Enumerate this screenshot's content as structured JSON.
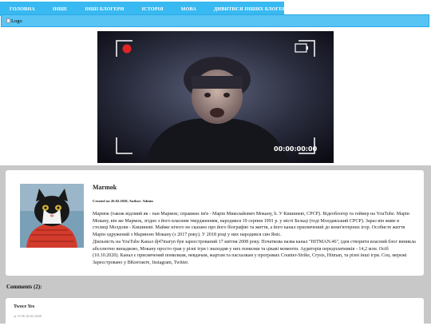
{
  "nav": {
    "items": [
      {
        "label": "ГОЛОВНА"
      },
      {
        "label": "ІНШЕ"
      },
      {
        "label": "ІНШІ БЛОГЕРИ"
      },
      {
        "label": "ІСТОРІЯ"
      },
      {
        "label": "МОВА"
      },
      {
        "label": "ДИВИТИСЯ ІНШИХ БЛОГЕРІВ"
      }
    ]
  },
  "header": {
    "logo_alt": "Logo"
  },
  "video": {
    "timecode": "00:00:00:00",
    "rec_color": "#e12424"
  },
  "post": {
    "title": "Marmok",
    "meta": "Created on 26.02.2020, Author: Admin",
    "paragraph1": "Мармок (також відомий як - пан Мармок; справжнє ім'я - Марін Миколайович Мокану, b. У Кишиневі, СРСР). Відеоблогер та геймер на YouTube. Марін Мокану, він же Мармок, згідно з його власним твердженням, народився 19 серпня 1991 р. у місті Бельці (тоді Молдавський СРСР). Зараз він живе в столиці Молдови - Кишиневі. Майже нічого не сказано про його біографію та життя, а його канал присвячений до комп'ютерних ігор. Особисте життя Марін одружений з Мариною Мокану (з 2017 року). У 2018 році у них народився син Яніс.",
    "paragraph2": "Діяльність на YouTube Канал dj47maryn був зареєстрований 17 квітня 2008 року. Початкова назва канал \"HITMAN.46\", ідея створити власний блог виникла абсолютно випадково, Мокану просто грав у різні ігри і знаходив у них помилки та цікаві моменти. Аудиторія передплатників - 14,2 млн. Осіб (10.10.2020). Канал є присвячений помилкам, невдачам, жартам та пасхалкам у програмах Counter-Strike, Crysis, Hitman, та різні інші ігри. Соц. мережі Зареєстровано у ВКонтакте, Instagram, Twitter."
  },
  "comments": {
    "heading": "Comments (2):",
    "items": [
      {
        "author": "Twoce Yes",
        "date": "at 19:36 26.02.2020"
      }
    ]
  },
  "colors": {
    "nav_bg": "#38b9f2",
    "header_bg": "#57c4f4",
    "content_bg": "#c8c8c8"
  }
}
